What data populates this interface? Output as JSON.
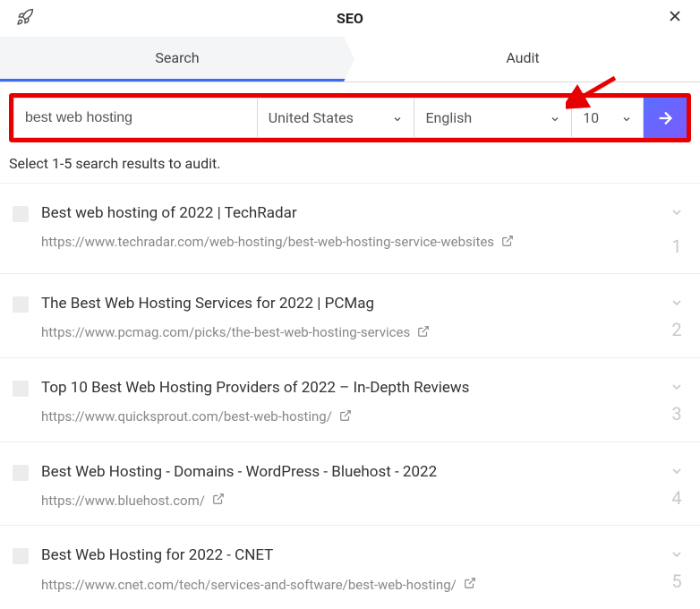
{
  "header": {
    "title": "SEO"
  },
  "tabs": {
    "search": "Search",
    "audit": "Audit"
  },
  "searchbar": {
    "query": "best web hosting",
    "country": "United States",
    "language": "English",
    "count": "10"
  },
  "instruction": "Select 1-5 search results to audit.",
  "results": [
    {
      "title": "Best web hosting of 2022 | TechRadar",
      "url": "https://www.techradar.com/web-hosting/best-web-hosting-service-websites",
      "rank": "1"
    },
    {
      "title": "The Best Web Hosting Services for 2022 | PCMag",
      "url": "https://www.pcmag.com/picks/the-best-web-hosting-services",
      "rank": "2"
    },
    {
      "title": "Top 10 Best Web Hosting Providers of 2022 – In-Depth Reviews",
      "url": "https://www.quicksprout.com/best-web-hosting/",
      "rank": "3"
    },
    {
      "title": "Best Web Hosting - Domains - WordPress - Bluehost - 2022",
      "url": "https://www.bluehost.com/",
      "rank": "4"
    },
    {
      "title": "Best Web Hosting for 2022 - CNET",
      "url": "https://www.cnet.com/tech/services-and-software/best-web-hosting/",
      "rank": "5"
    }
  ]
}
